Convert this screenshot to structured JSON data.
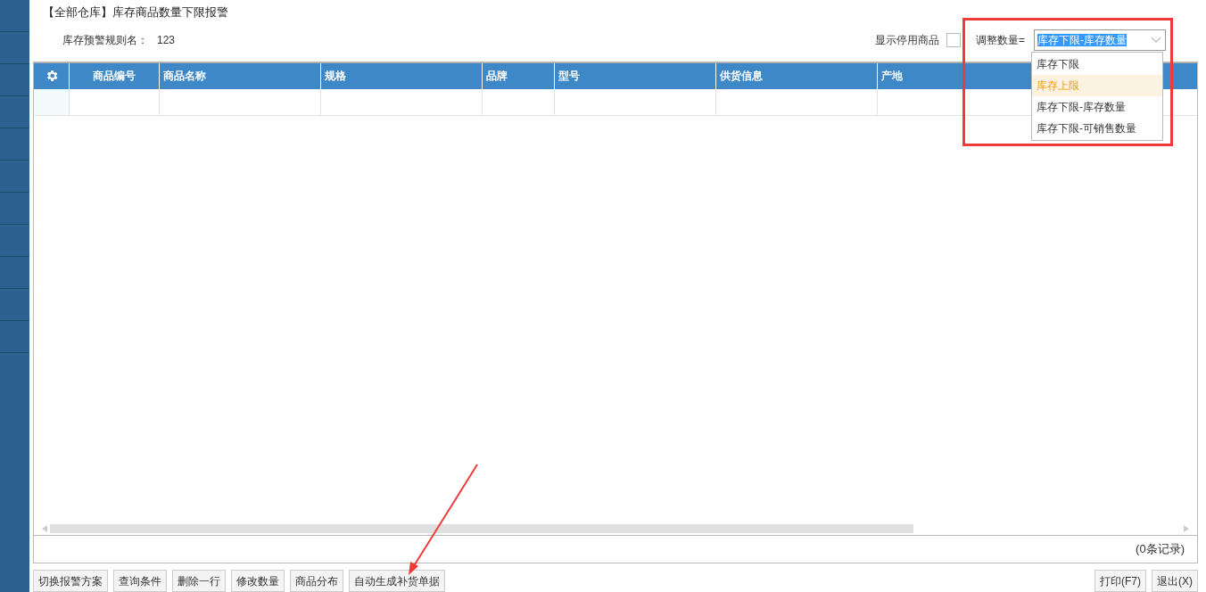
{
  "title": "【全部仓库】库存商品数量下限报警",
  "rule": {
    "label": "库存预警规则名：",
    "value": "123"
  },
  "show_disabled": {
    "label": "显示停用商品",
    "checked": false
  },
  "adjust": {
    "label": "调整数量=",
    "value": "库存下限-库存数量",
    "expanded": true,
    "options": [
      {
        "label": "库存下限",
        "highlighted": false
      },
      {
        "label": "库存上限",
        "highlighted": true
      },
      {
        "label": "库存下限-库存数量",
        "highlighted": false
      },
      {
        "label": "库存下限-可销售数量",
        "highlighted": false
      }
    ]
  },
  "table": {
    "columns": [
      "商品编号",
      "商品名称",
      "规格",
      "品牌",
      "型号",
      "供货信息",
      "产地"
    ]
  },
  "record_count": "(0条记录)",
  "buttons_left": [
    "切换报警方案",
    "查询条件",
    "删除一行",
    "修改数量",
    "商品分布",
    "自动生成补货单据"
  ],
  "buttons_right": [
    "打印(F7)",
    "退出(X)"
  ]
}
